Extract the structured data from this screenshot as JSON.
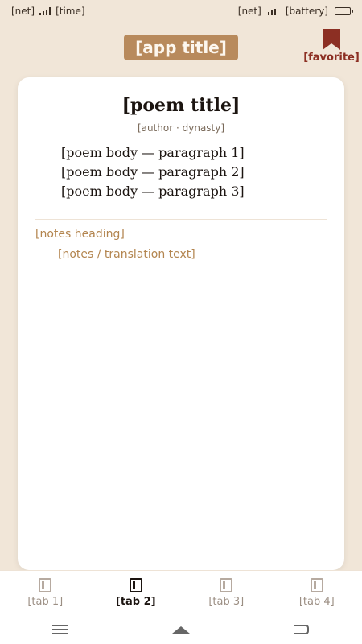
{
  "status_bar": {
    "time": "[time]",
    "network_left": "[net]",
    "network_right": "[net]",
    "battery_text": "[battery]",
    "battery_level": 0.5
  },
  "header": {
    "title": "[app title]",
    "favorite_label": "[favorite]"
  },
  "poem": {
    "title": "[poem title]",
    "author": "[author · dynasty]",
    "paragraphs": [
      "[poem body — paragraph 1]",
      "[poem body — paragraph 2]",
      "[poem body — paragraph 3]"
    ]
  },
  "notes": {
    "label": "[notes heading]",
    "text": "[notes / translation text]"
  },
  "tabs": [
    {
      "label": "[tab 1]",
      "active": false
    },
    {
      "label": "[tab 2]",
      "active": true
    },
    {
      "label": "[tab 3]",
      "active": false
    },
    {
      "label": "[tab 4]",
      "active": false
    }
  ],
  "colors": {
    "accent": "#8c2f23",
    "note_text": "#b3854f",
    "background": "#f1e6d8"
  },
  "icons": {
    "favorite": "bookmark-icon",
    "tab": "book-icon",
    "nav_menu": "menu-icon",
    "nav_home": "home-icon",
    "nav_back": "back-icon"
  }
}
